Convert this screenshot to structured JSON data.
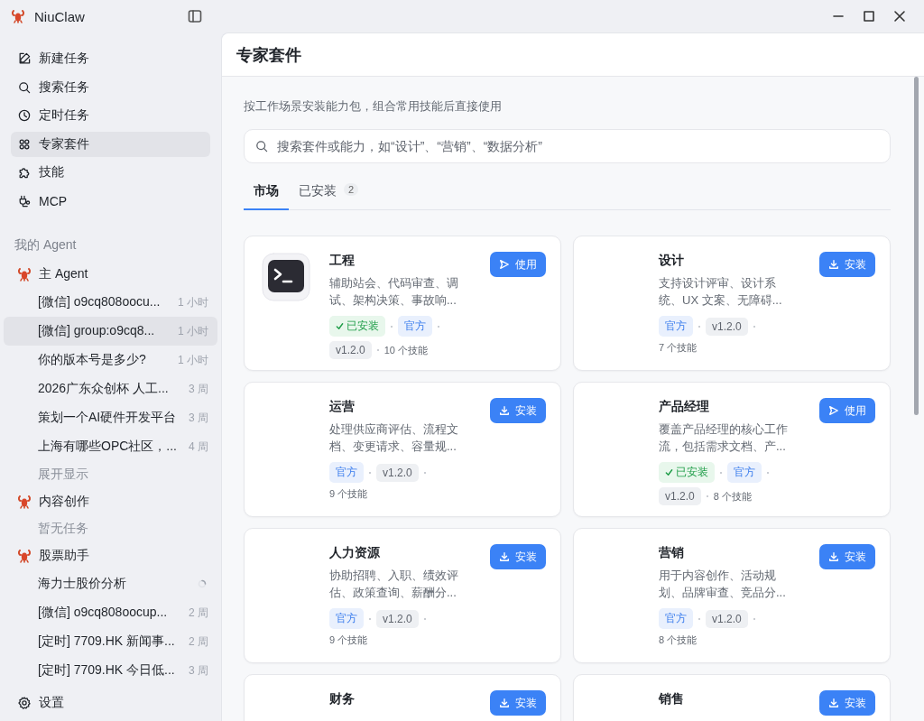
{
  "app": {
    "title": "NiuClaw"
  },
  "nav": [
    {
      "label": "新建任务",
      "selected": false
    },
    {
      "label": "搜索任务",
      "selected": false
    },
    {
      "label": "定时任务",
      "selected": false
    },
    {
      "label": "专家套件",
      "selected": true
    },
    {
      "label": "技能",
      "selected": false
    },
    {
      "label": "MCP",
      "selected": false
    }
  ],
  "agents_section": {
    "title": "我的 Agent"
  },
  "agents": [
    {
      "name": "主 Agent",
      "tasks": [
        {
          "title": "[微信] o9cq808oocu...",
          "kind": "done",
          "time": "1 小时",
          "selected": false
        },
        {
          "title": "[微信] group:o9cq8...",
          "kind": "done",
          "time": "1 小时",
          "selected": true
        },
        {
          "title": "你的版本号是多少?",
          "kind": "done",
          "time": "1 小时",
          "selected": false
        },
        {
          "title": "2026广东众创杯 人工...",
          "kind": "done",
          "time": "3 周",
          "selected": false
        },
        {
          "title": "策划一个AI硬件开发平台",
          "kind": "done",
          "time": "3 周",
          "selected": false
        },
        {
          "title": "上海有哪些OPC社区，...",
          "kind": "done",
          "time": "4 周",
          "selected": false
        }
      ],
      "more": "展开显示"
    },
    {
      "name": "内容创作",
      "empty": "暂无任务"
    },
    {
      "name": "股票助手",
      "tasks": [
        {
          "title": "海力士股价分析",
          "kind": "running",
          "selected": false
        },
        {
          "title": "[微信] o9cq808oocup...",
          "kind": "done",
          "time": "2 周",
          "selected": false
        },
        {
          "title": "[定时] 7709.HK 新闻事...",
          "kind": "done",
          "time": "2 周",
          "selected": false
        },
        {
          "title": "[定时] 7709.HK 今日低...",
          "kind": "done",
          "time": "3 周",
          "selected": false
        }
      ]
    }
  ],
  "settings": {
    "label": "设置"
  },
  "page": {
    "title": "专家套件",
    "description": "按工作场景安装能力包，组合常用技能后直接使用",
    "search": {
      "placeholder": "搜索套件或能力，如“设计”、“营销”、“数据分析”"
    },
    "tabs": [
      {
        "label": "市场",
        "selected": true
      },
      {
        "label": "已安装",
        "count": "2",
        "selected": false
      }
    ],
    "kits": [
      {
        "name": "工程",
        "description": "辅助站会、代码审查、调试、架构决策、事故响...",
        "action": {
          "kind": "use",
          "label": "使用"
        },
        "installed": true,
        "installed_label": "已安装",
        "source": "官方",
        "version": "v1.2.0",
        "skills": "10 个技能"
      },
      {
        "name": "设计",
        "description": "支持设计评审、设计系统、UX 文案、无障碍...",
        "action": {
          "kind": "install",
          "label": "安装"
        },
        "installed": false,
        "source": "官方",
        "version": "v1.2.0",
        "skills": "7 个技能"
      },
      {
        "name": "运营",
        "description": "处理供应商评估、流程文档、变更请求、容量规...",
        "action": {
          "kind": "install",
          "label": "安装"
        },
        "installed": false,
        "source": "官方",
        "version": "v1.2.0",
        "skills": "9 个技能"
      },
      {
        "name": "产品经理",
        "description": "覆盖产品经理的核心工作流，包括需求文档、产...",
        "action": {
          "kind": "use",
          "label": "使用"
        },
        "installed": true,
        "installed_label": "已安装",
        "source": "官方",
        "version": "v1.2.0",
        "skills": "8 个技能"
      },
      {
        "name": "人力资源",
        "description": "协助招聘、入职、绩效评估、政策查询、薪酬分...",
        "action": {
          "kind": "install",
          "label": "安装"
        },
        "installed": false,
        "source": "官方",
        "version": "v1.2.0",
        "skills": "9 个技能"
      },
      {
        "name": "营销",
        "description": "用于内容创作、活动规划、品牌审查、竞品分...",
        "action": {
          "kind": "install",
          "label": "安装"
        },
        "installed": false,
        "source": "官方",
        "version": "v1.2.0",
        "skills": "8 个技能"
      },
      {
        "name": "财务",
        "action": {
          "kind": "install",
          "label": "安装"
        }
      },
      {
        "name": "销售",
        "action": {
          "kind": "install",
          "label": "安装"
        }
      }
    ]
  }
}
